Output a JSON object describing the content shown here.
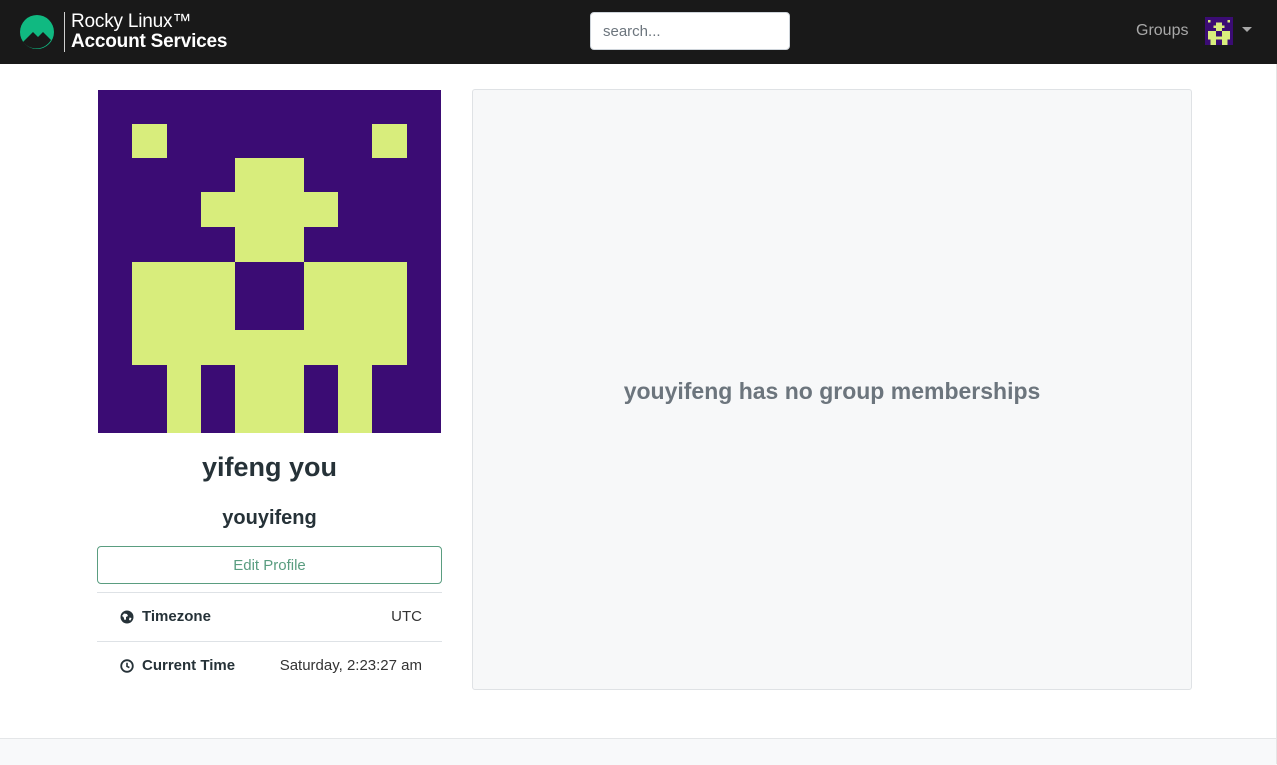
{
  "navbar": {
    "brand_line1": "Rocky Linux™",
    "brand_line2": "Account Services",
    "search_placeholder": "search...",
    "groups_link": "Groups",
    "logo_icon": "rocky-linux-logo-icon",
    "user_menu_icon": "user-avatar-icon"
  },
  "profile": {
    "full_name": "yifeng you",
    "username": "youyifeng",
    "edit_button": "Edit Profile",
    "avatar_icon": "identicon-avatar"
  },
  "details": [
    {
      "icon": "globe-icon",
      "label": "Timezone",
      "value": "UTC"
    },
    {
      "icon": "clock-icon",
      "label": "Current Time",
      "value": "Saturday, 2:23:27 am"
    }
  ],
  "groups": {
    "empty_message": "youyifeng has no group memberships"
  },
  "colors": {
    "navbar_bg": "#191919",
    "brand_green": "#10b981",
    "avatar_bg": "#3b0c74",
    "avatar_fg": "#d8ed7c",
    "button_accent": "#5a9d80",
    "panel_bg": "#f7f8f9",
    "muted_text": "#6c757d"
  }
}
